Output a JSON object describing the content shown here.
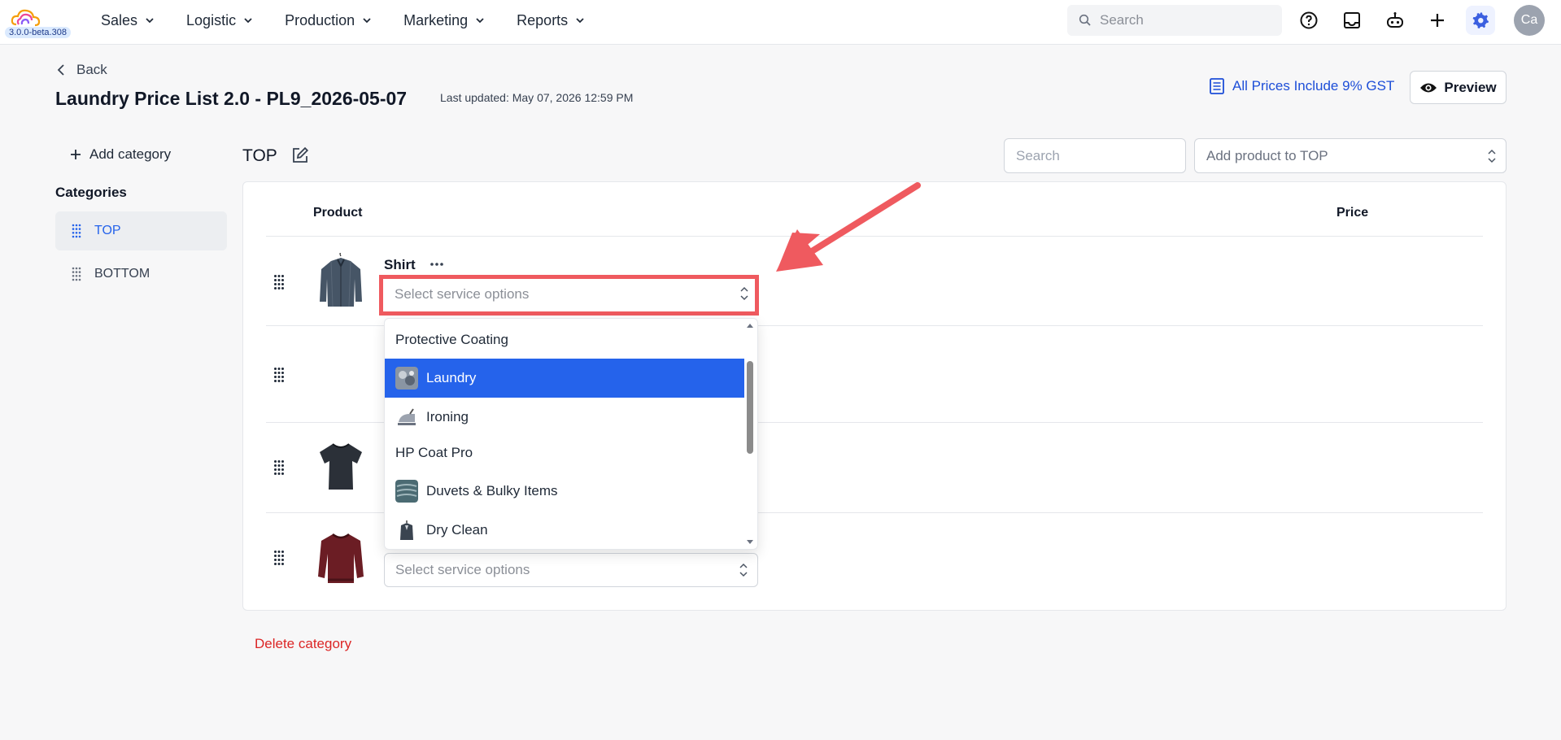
{
  "app": {
    "version": "3.0.0-beta.308",
    "avatar_initials": "Ca",
    "accent_color": "#2563eb"
  },
  "nav": {
    "items": [
      {
        "label": "Sales"
      },
      {
        "label": "Logistic"
      },
      {
        "label": "Production"
      },
      {
        "label": "Marketing"
      },
      {
        "label": "Reports"
      }
    ],
    "search_placeholder": "Search",
    "icons": [
      "help-icon",
      "inbox-icon",
      "robot-icon",
      "plus-icon",
      "gear-icon"
    ]
  },
  "header": {
    "back_label": "Back",
    "title": "Laundry Price List 2.0 - PL9_2026-05-07",
    "last_updated": "Last updated: May 07, 2026 12:59 PM",
    "gst_label": "All Prices Include 9% GST",
    "preview_label": "Preview"
  },
  "sidebar": {
    "add_category_label": "Add category",
    "heading": "Categories",
    "categories": [
      {
        "label": "TOP",
        "active": true
      },
      {
        "label": "BOTTOM",
        "active": false
      }
    ]
  },
  "main": {
    "category_title": "TOP",
    "search_placeholder": "Search",
    "add_product_placeholder": "Add product to TOP",
    "columns": {
      "product": "Product",
      "price": "Price"
    },
    "rows": [
      {
        "name": "Shirt",
        "select_placeholder": "Select service options",
        "thumb": "shirt-icon"
      },
      {
        "name": "",
        "select_placeholder": "",
        "thumb": ""
      },
      {
        "name": "",
        "select_placeholder": "",
        "thumb": "tshirt-icon"
      },
      {
        "name": "",
        "select_placeholder": "Select service options",
        "thumb": "sweater-icon"
      }
    ],
    "delete_category_label": "Delete category"
  },
  "dropdown": {
    "options": [
      {
        "label": "Protective Coating",
        "type": "group"
      },
      {
        "label": "Laundry",
        "type": "item",
        "selected": true
      },
      {
        "label": "Ironing",
        "type": "item"
      },
      {
        "label": "HP Coat Pro",
        "type": "group"
      },
      {
        "label": "Duvets & Bulky Items",
        "type": "item"
      },
      {
        "label": "Dry Clean",
        "type": "item"
      }
    ]
  },
  "annotation": {
    "highlight_color": "#ef5a5f"
  }
}
